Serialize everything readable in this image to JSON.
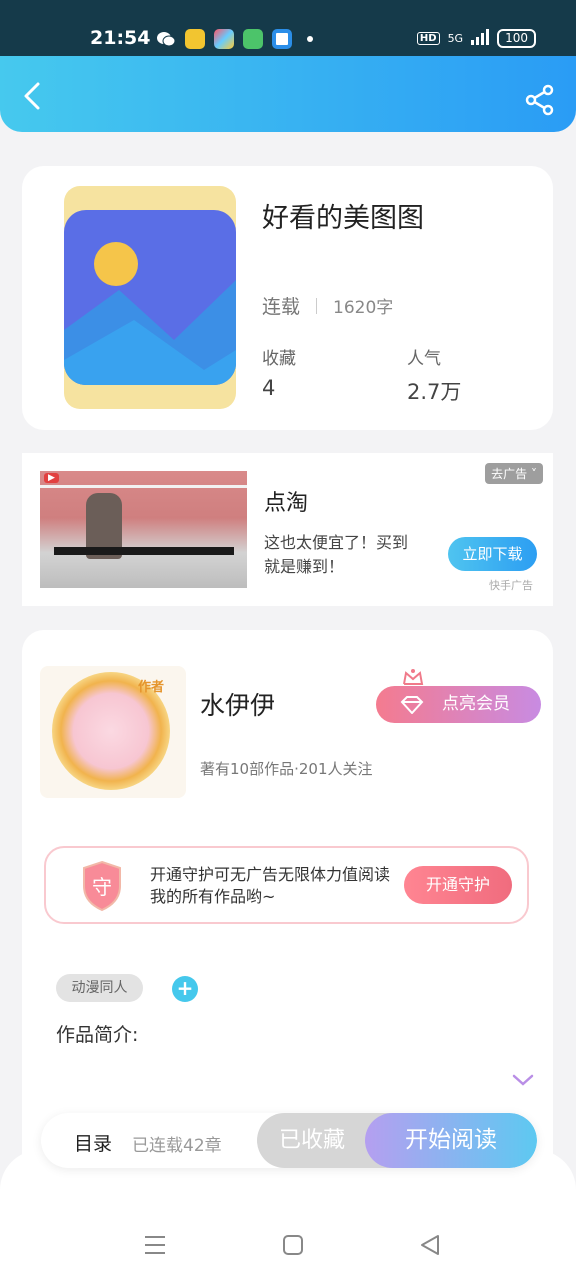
{
  "status_bar": {
    "time": "21:54",
    "network": "HD",
    "signal": "5G",
    "battery": "100"
  },
  "header": {
    "back_icon": "chevron-left-icon",
    "share_icon": "share-icon",
    "accent_colors": [
      "#46c9ee",
      "#2a9cf5"
    ]
  },
  "book": {
    "title": "好看的美图图",
    "status": "连载",
    "word_count": "1620字",
    "favorites_label": "收藏",
    "favorites_value": "4",
    "popularity_label": "人气",
    "popularity_value": "2.7万"
  },
  "ad": {
    "title": "点淘",
    "description": "这也太便宜了！买到就是赚到！",
    "remove_label": "去广告",
    "cta_label": "立即下载",
    "source": "快手广告"
  },
  "author": {
    "name": "水伊伊",
    "avatar_tag": "作者",
    "stats": "著有10部作品·201人关注",
    "vip_label": "点亮会员"
  },
  "guard": {
    "shield_text": "守",
    "text": "开通守护可无广告无限体力值阅读我的所有作品哟~",
    "button_label": "开通守护"
  },
  "tags": {
    "items": [
      "动漫同人"
    ],
    "add_label": "+"
  },
  "intro": {
    "label": "作品简介:"
  },
  "bottom_bar": {
    "toc_label": "目录",
    "toc_count": "已连载42章",
    "collected_label": "已收藏",
    "read_label": "开始阅读"
  },
  "nav": {
    "icons": [
      "menu-icon",
      "home-square-icon",
      "back-triangle-icon"
    ]
  }
}
